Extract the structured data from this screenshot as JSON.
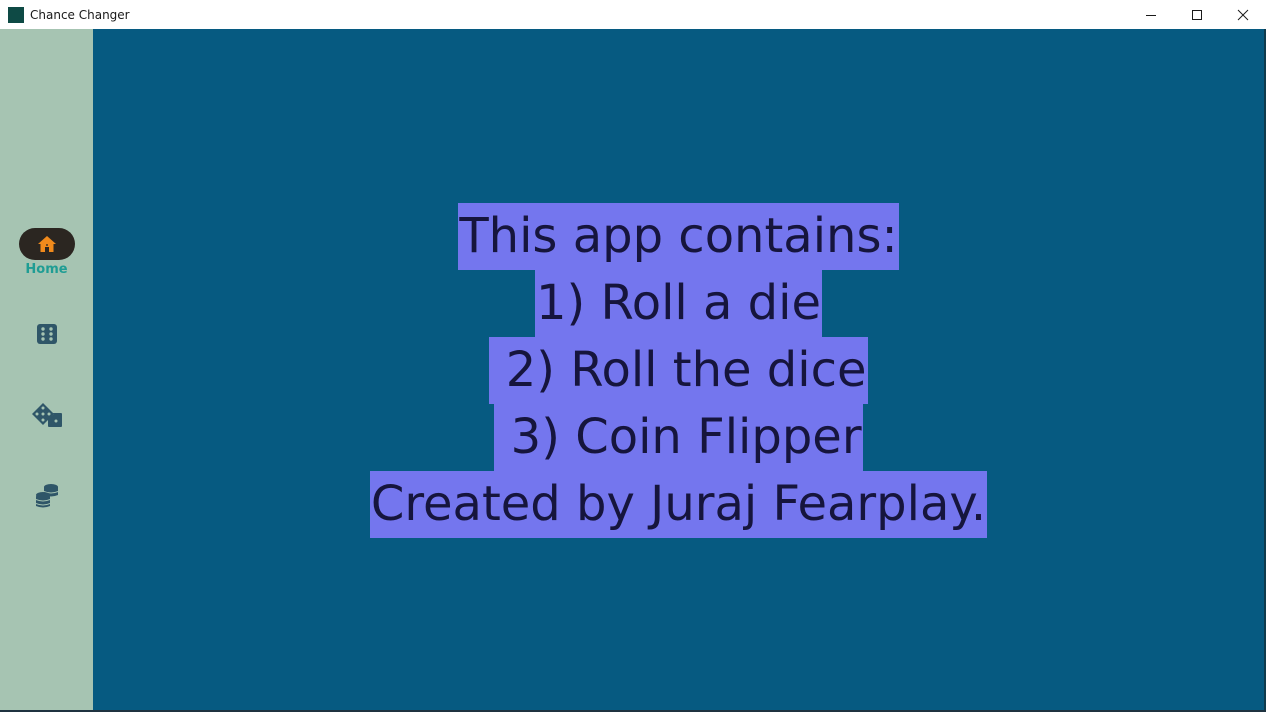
{
  "window": {
    "title": "Chance Changer",
    "controls": [
      "minimize",
      "maximize",
      "close"
    ]
  },
  "sidebar": {
    "items": [
      {
        "icon": "home-icon",
        "label": "Home",
        "selected": true
      },
      {
        "icon": "die-icon",
        "label": "",
        "selected": false
      },
      {
        "icon": "dice-icon",
        "label": "",
        "selected": false
      },
      {
        "icon": "coins-icon",
        "label": "",
        "selected": false
      }
    ]
  },
  "main": {
    "lines": [
      "This app contains:",
      "1) Roll a die",
      " 2) Roll the dice",
      " 3) Coin Flipper",
      "Created by Juraj Fearplay."
    ]
  },
  "colors": {
    "titlebar": "#ffffff",
    "sidebar": "#a6c4b2",
    "main_background": "#065a81",
    "text_highlight": "#7476ee",
    "text": "#16153d",
    "nav_selected_pill": "#2b2621",
    "nav_selected_icon": "#f08a1c",
    "nav_label": "#1f9d94",
    "nav_icon": "#2f5668"
  }
}
